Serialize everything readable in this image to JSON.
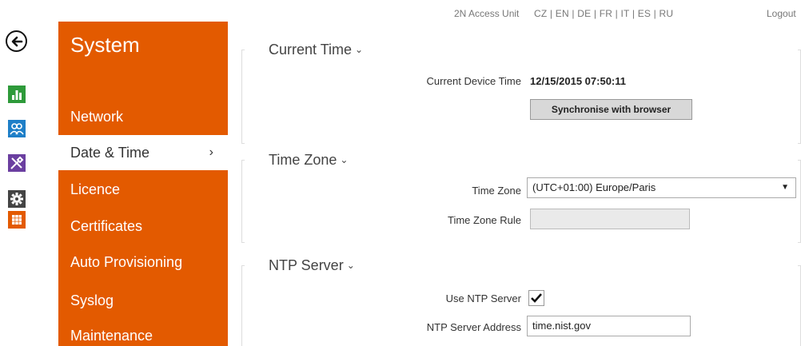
{
  "topbar": {
    "product": "2N Access Unit",
    "languages": "CZ | EN | DE | FR | IT | ES | RU",
    "logout": "Logout"
  },
  "sidemenu": {
    "title": "System",
    "items": [
      {
        "label": "Network"
      },
      {
        "label": "Date & Time",
        "chevron": "›"
      },
      {
        "label": "Licence"
      },
      {
        "label": "Certificates"
      },
      {
        "label": "Auto Provisioning"
      },
      {
        "label": "Syslog"
      },
      {
        "label": "Maintenance"
      }
    ]
  },
  "current_time": {
    "title": "Current Time",
    "device_time_label": "Current Device Time",
    "device_time_value": "12/15/2015 07:50:11",
    "sync_button": "Synchronise with browser"
  },
  "time_zone": {
    "title": "Time Zone",
    "zone_label": "Time Zone",
    "zone_value": "(UTC+01:00) Europe/Paris",
    "rule_label": "Time Zone Rule",
    "rule_value": ""
  },
  "ntp": {
    "title": "NTP Server",
    "use_label": "Use NTP Server",
    "use_checked": true,
    "address_label": "NTP Server Address",
    "address_value": "time.nist.gov"
  },
  "icons": {
    "back": "back-arrow-icon",
    "status": "bar-chart-icon",
    "directory": "users-icon",
    "hardware": "tools-icon",
    "services": "gear-icon",
    "system": "grid-icon"
  },
  "colors": {
    "menu_orange": "#e35a00",
    "status_green": "#2e9a3a",
    "directory_blue": "#1e7fc8",
    "hardware_purple": "#6b3fa0",
    "services_dark": "#444444"
  }
}
